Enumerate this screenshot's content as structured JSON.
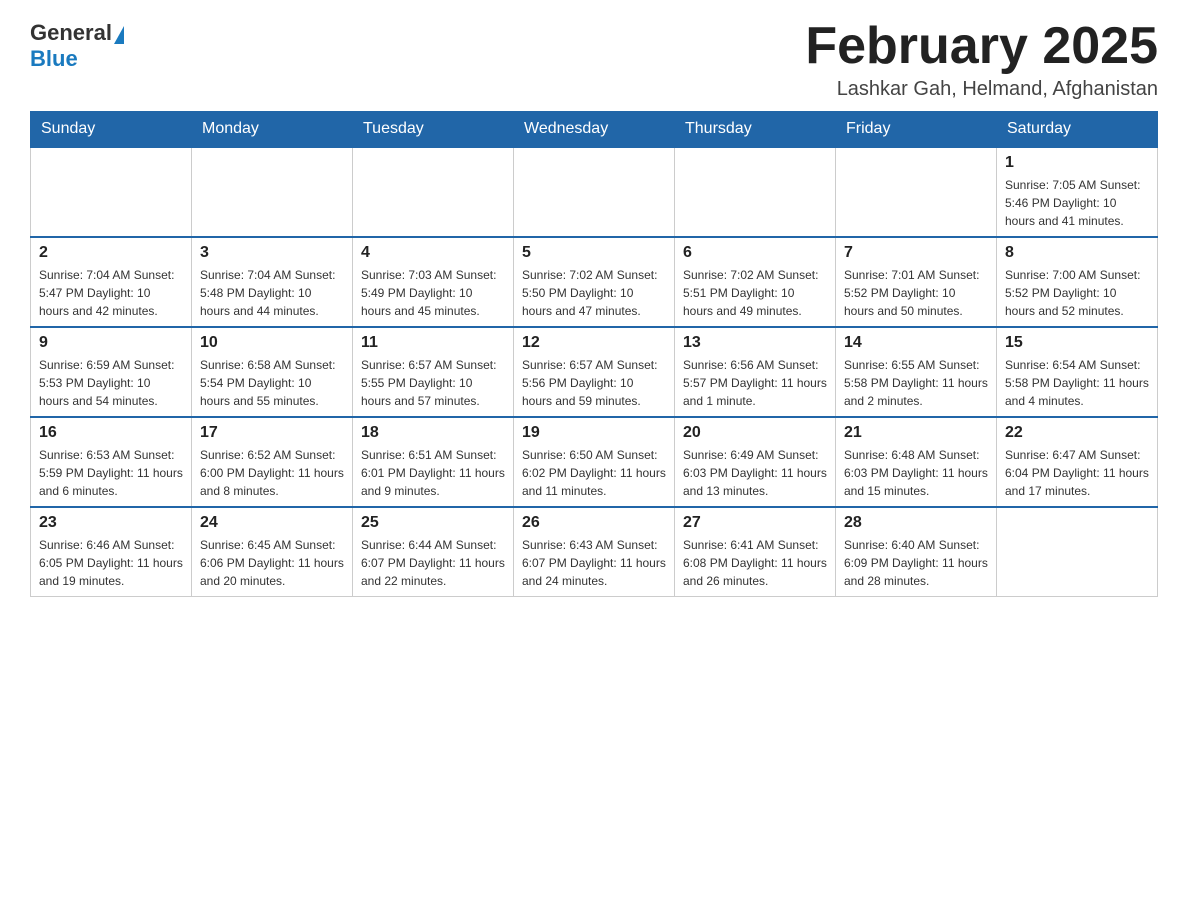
{
  "header": {
    "logo_general": "General",
    "logo_blue": "Blue",
    "month_title": "February 2025",
    "location": "Lashkar Gah, Helmand, Afghanistan"
  },
  "days_of_week": [
    "Sunday",
    "Monday",
    "Tuesday",
    "Wednesday",
    "Thursday",
    "Friday",
    "Saturday"
  ],
  "weeks": [
    [
      {
        "day": "",
        "info": ""
      },
      {
        "day": "",
        "info": ""
      },
      {
        "day": "",
        "info": ""
      },
      {
        "day": "",
        "info": ""
      },
      {
        "day": "",
        "info": ""
      },
      {
        "day": "",
        "info": ""
      },
      {
        "day": "1",
        "info": "Sunrise: 7:05 AM\nSunset: 5:46 PM\nDaylight: 10 hours and 41 minutes."
      }
    ],
    [
      {
        "day": "2",
        "info": "Sunrise: 7:04 AM\nSunset: 5:47 PM\nDaylight: 10 hours and 42 minutes."
      },
      {
        "day": "3",
        "info": "Sunrise: 7:04 AM\nSunset: 5:48 PM\nDaylight: 10 hours and 44 minutes."
      },
      {
        "day": "4",
        "info": "Sunrise: 7:03 AM\nSunset: 5:49 PM\nDaylight: 10 hours and 45 minutes."
      },
      {
        "day": "5",
        "info": "Sunrise: 7:02 AM\nSunset: 5:50 PM\nDaylight: 10 hours and 47 minutes."
      },
      {
        "day": "6",
        "info": "Sunrise: 7:02 AM\nSunset: 5:51 PM\nDaylight: 10 hours and 49 minutes."
      },
      {
        "day": "7",
        "info": "Sunrise: 7:01 AM\nSunset: 5:52 PM\nDaylight: 10 hours and 50 minutes."
      },
      {
        "day": "8",
        "info": "Sunrise: 7:00 AM\nSunset: 5:52 PM\nDaylight: 10 hours and 52 minutes."
      }
    ],
    [
      {
        "day": "9",
        "info": "Sunrise: 6:59 AM\nSunset: 5:53 PM\nDaylight: 10 hours and 54 minutes."
      },
      {
        "day": "10",
        "info": "Sunrise: 6:58 AM\nSunset: 5:54 PM\nDaylight: 10 hours and 55 minutes."
      },
      {
        "day": "11",
        "info": "Sunrise: 6:57 AM\nSunset: 5:55 PM\nDaylight: 10 hours and 57 minutes."
      },
      {
        "day": "12",
        "info": "Sunrise: 6:57 AM\nSunset: 5:56 PM\nDaylight: 10 hours and 59 minutes."
      },
      {
        "day": "13",
        "info": "Sunrise: 6:56 AM\nSunset: 5:57 PM\nDaylight: 11 hours and 1 minute."
      },
      {
        "day": "14",
        "info": "Sunrise: 6:55 AM\nSunset: 5:58 PM\nDaylight: 11 hours and 2 minutes."
      },
      {
        "day": "15",
        "info": "Sunrise: 6:54 AM\nSunset: 5:58 PM\nDaylight: 11 hours and 4 minutes."
      }
    ],
    [
      {
        "day": "16",
        "info": "Sunrise: 6:53 AM\nSunset: 5:59 PM\nDaylight: 11 hours and 6 minutes."
      },
      {
        "day": "17",
        "info": "Sunrise: 6:52 AM\nSunset: 6:00 PM\nDaylight: 11 hours and 8 minutes."
      },
      {
        "day": "18",
        "info": "Sunrise: 6:51 AM\nSunset: 6:01 PM\nDaylight: 11 hours and 9 minutes."
      },
      {
        "day": "19",
        "info": "Sunrise: 6:50 AM\nSunset: 6:02 PM\nDaylight: 11 hours and 11 minutes."
      },
      {
        "day": "20",
        "info": "Sunrise: 6:49 AM\nSunset: 6:03 PM\nDaylight: 11 hours and 13 minutes."
      },
      {
        "day": "21",
        "info": "Sunrise: 6:48 AM\nSunset: 6:03 PM\nDaylight: 11 hours and 15 minutes."
      },
      {
        "day": "22",
        "info": "Sunrise: 6:47 AM\nSunset: 6:04 PM\nDaylight: 11 hours and 17 minutes."
      }
    ],
    [
      {
        "day": "23",
        "info": "Sunrise: 6:46 AM\nSunset: 6:05 PM\nDaylight: 11 hours and 19 minutes."
      },
      {
        "day": "24",
        "info": "Sunrise: 6:45 AM\nSunset: 6:06 PM\nDaylight: 11 hours and 20 minutes."
      },
      {
        "day": "25",
        "info": "Sunrise: 6:44 AM\nSunset: 6:07 PM\nDaylight: 11 hours and 22 minutes."
      },
      {
        "day": "26",
        "info": "Sunrise: 6:43 AM\nSunset: 6:07 PM\nDaylight: 11 hours and 24 minutes."
      },
      {
        "day": "27",
        "info": "Sunrise: 6:41 AM\nSunset: 6:08 PM\nDaylight: 11 hours and 26 minutes."
      },
      {
        "day": "28",
        "info": "Sunrise: 6:40 AM\nSunset: 6:09 PM\nDaylight: 11 hours and 28 minutes."
      },
      {
        "day": "",
        "info": ""
      }
    ]
  ]
}
